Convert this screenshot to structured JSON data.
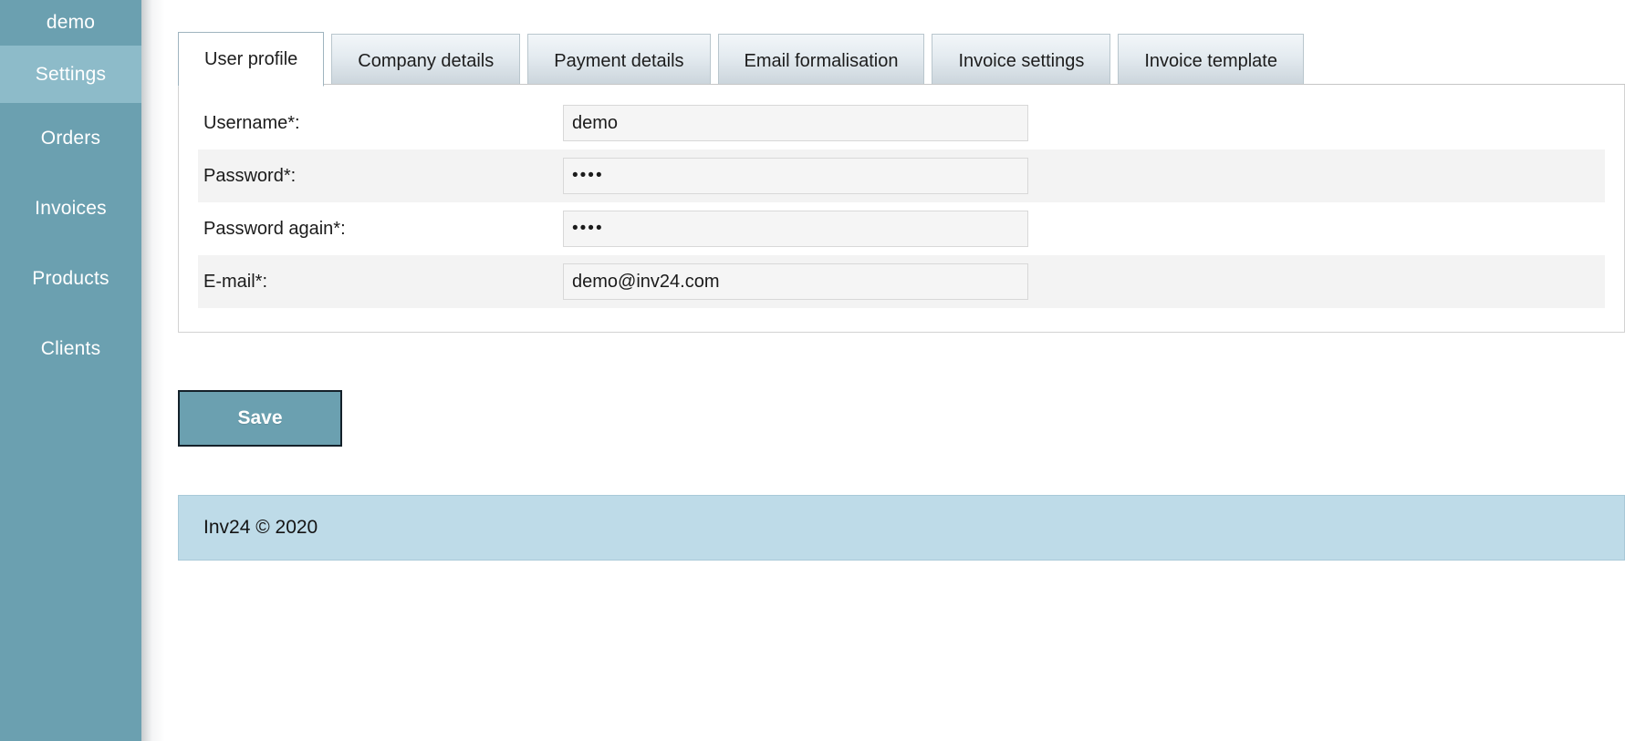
{
  "sidebar": {
    "brand": "demo",
    "items": [
      {
        "label": "Settings",
        "active": true
      },
      {
        "label": "Orders",
        "active": false
      },
      {
        "label": "Invoices",
        "active": false
      },
      {
        "label": "Products",
        "active": false
      },
      {
        "label": "Clients",
        "active": false
      }
    ]
  },
  "tabs": [
    {
      "label": "User profile",
      "active": true
    },
    {
      "label": "Company details",
      "active": false
    },
    {
      "label": "Payment details",
      "active": false
    },
    {
      "label": "Email formalisation",
      "active": false
    },
    {
      "label": "Invoice settings",
      "active": false
    },
    {
      "label": "Invoice template",
      "active": false
    }
  ],
  "form": {
    "rows": [
      {
        "label": "Username*:",
        "value": "demo",
        "type": "text"
      },
      {
        "label": "Password*:",
        "value": "••••",
        "type": "password"
      },
      {
        "label": "Password again*:",
        "value": "••••",
        "type": "password"
      },
      {
        "label": "E-mail*:",
        "value": "demo@inv24.com",
        "type": "text"
      }
    ]
  },
  "actions": {
    "save_label": "Save"
  },
  "footer": {
    "text": "Inv24 © 2020"
  },
  "colors": {
    "sidebar": "#6ba0b0",
    "sidebar_active": "#8dbbc9",
    "accent_button": "#6ba0b0",
    "footer": "#bedbe8",
    "row_alt": "#f3f3f3",
    "input_bg": "#f5f5f5"
  }
}
